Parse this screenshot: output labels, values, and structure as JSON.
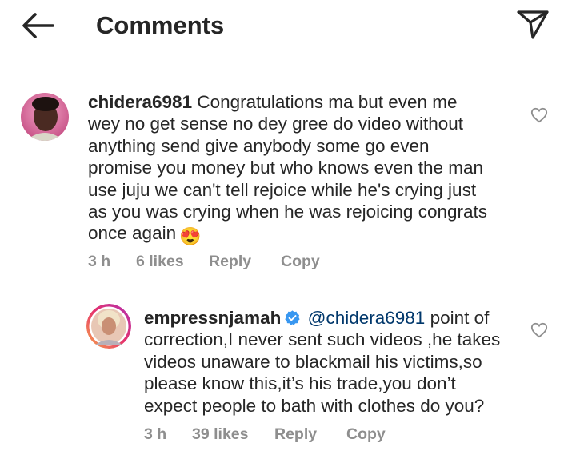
{
  "header": {
    "title": "Comments",
    "back_icon": "arrow-left-icon",
    "share_icon": "paper-plane-icon"
  },
  "comments": [
    {
      "username": "chidera6981",
      "text_lines": [
        "Congratulations ma but even me",
        "wey no get sense no dey gree do video without",
        "anything send give anybody some go even",
        "promise you money but who knows even the man",
        "use juju we can't tell rejoice while he's crying just",
        "as you was crying when he was rejoicing congrats",
        "once again"
      ],
      "emoji": "😍",
      "time": "3 h",
      "likes": "6 likes",
      "reply_label": "Reply",
      "copy_label": "Copy"
    },
    {
      "username": "empressnjamah",
      "verified": true,
      "mention": "@chidera6981",
      "text_lines": [
        "point of",
        "correction,I never sent such videos ,he takes",
        "videos unaware to blackmail his victims,so",
        "please know this,it’s his trade,you don’t",
        "expect people to bath with clothes do you?"
      ],
      "time": "3 h",
      "likes": "39 likes",
      "reply_label": "Reply",
      "copy_label": "Copy"
    }
  ],
  "colors": {
    "text": "#262626",
    "secondary": "#8e8e8e",
    "mention": "#00376b",
    "verified": "#3897f0"
  }
}
